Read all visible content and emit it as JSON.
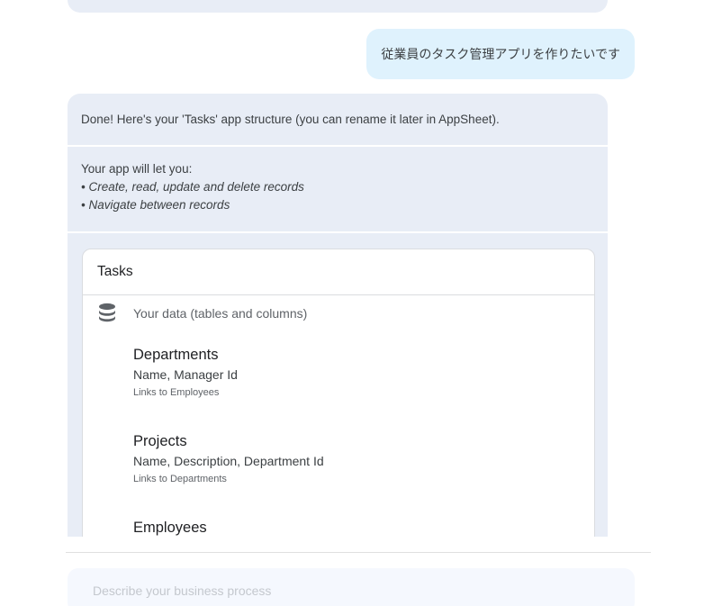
{
  "conversation": {
    "user_message": "従業員のタスク管理アプリを作りたいです",
    "bot_intro": "Done! Here's your 'Tasks' app structure (you can rename it later in AppSheet).",
    "features_heading": "Your app will let you:",
    "features": [
      "• Create, read, update and delete records",
      "• Navigate between records"
    ]
  },
  "app": {
    "name": "Tasks",
    "data_section": {
      "icon": "database-icon",
      "label": "Your data (tables and columns)"
    },
    "tables": [
      {
        "name": "Departments",
        "columns": "Name, Manager Id",
        "links": "Links to Employees"
      },
      {
        "name": "Projects",
        "columns": "Name, Description, Department Id",
        "links": "Links to Departments"
      },
      {
        "name": "Employees",
        "columns": "",
        "links": ""
      }
    ]
  },
  "composer": {
    "placeholder": "Describe your business process",
    "value": ""
  },
  "colors": {
    "user_bubble": "#dff2fd",
    "bot_bubble": "#e8edf6",
    "composer_bg": "#f5f8fe"
  }
}
